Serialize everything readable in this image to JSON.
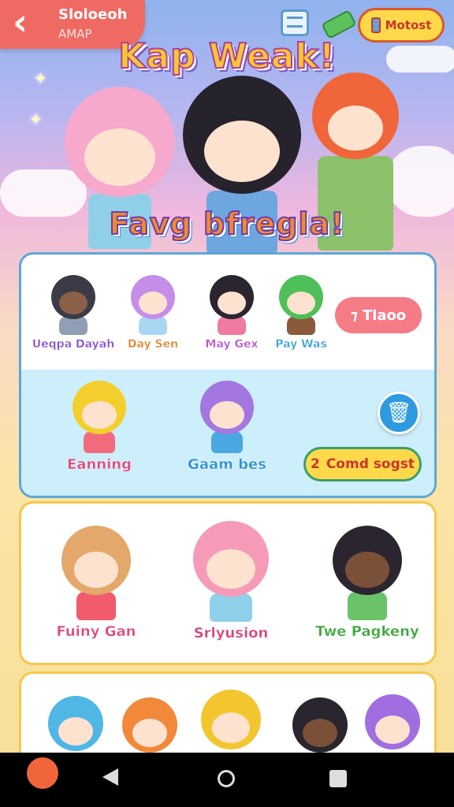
{
  "header": {
    "back_title": "Sloloeoh",
    "back_subtitle": "AMAP",
    "mode_label": "Motost"
  },
  "hero": {
    "title": "Kap Weak!",
    "subtitle": "Favg bfregla!"
  },
  "roster_card": {
    "top_row": [
      {
        "name": "Ueqpa Dayah",
        "hair": "#3b3b48",
        "outfit": "#8fa0b6",
        "label_color": "#8a4bd6"
      },
      {
        "name": "Day Sen",
        "hair": "#c58de8",
        "outfit": "#a8d6f2",
        "label_color": "#e0842a"
      },
      {
        "name": "May Gex",
        "hair": "#2a2530",
        "outfit": "#f07aa0",
        "label_color": "#b84fcf"
      },
      {
        "name": "Pay Was",
        "hair": "#4fbf5a",
        "outfit": "#8b5a3a",
        "label_color": "#3aa0d8"
      }
    ],
    "action_label": "Tlaoo",
    "bottom_row": [
      {
        "name": "Eanning",
        "hair": "#f3cf2e",
        "outfit": "#f26b7d",
        "label_color": "#e0487c"
      },
      {
        "name": "Gaam bes",
        "hair": "#a376e0",
        "outfit": "#4aa8e0",
        "label_color": "#2e8fd0"
      }
    ],
    "confirm_label": "Comd sogst",
    "confirm_icon": "2"
  },
  "featured_card": {
    "items": [
      {
        "name": "Fuiny Gan",
        "hair": "#e3a86a",
        "outfit": "#f25b6b",
        "label_color": "#e0487c"
      },
      {
        "name": "Srlyusion",
        "hair": "#f59bb8",
        "outfit": "#8fd0ea",
        "label_color": "#d8407c"
      },
      {
        "name": "Twe Pagkeny",
        "hair": "#2b2530",
        "outfit": "#6ac36a",
        "label_color": "#3aa83a"
      }
    ]
  },
  "more_card": {
    "items": [
      {
        "hair": "#4fb6e6",
        "outfit": "#f0a060"
      },
      {
        "hair": "#f2893a",
        "outfit": "#e85a6a"
      },
      {
        "hair": "#f3c52e",
        "outfit": "#3a6fd0"
      },
      {
        "hair": "#2b2530",
        "outfit": "#7bc26a"
      },
      {
        "hair": "#a06ee0",
        "outfit": "#6aaee0"
      }
    ]
  },
  "colors": {
    "accent_red": "#ef6a63",
    "accent_yellow": "#ffd94a",
    "delete_blue": "#2e9be0",
    "pill_pink": "#f57b86"
  },
  "icons": [
    "back-arrow-icon",
    "calendar-icon",
    "cash-icon",
    "brush-icon",
    "trash-icon",
    "recents-icon",
    "home-icon"
  ]
}
